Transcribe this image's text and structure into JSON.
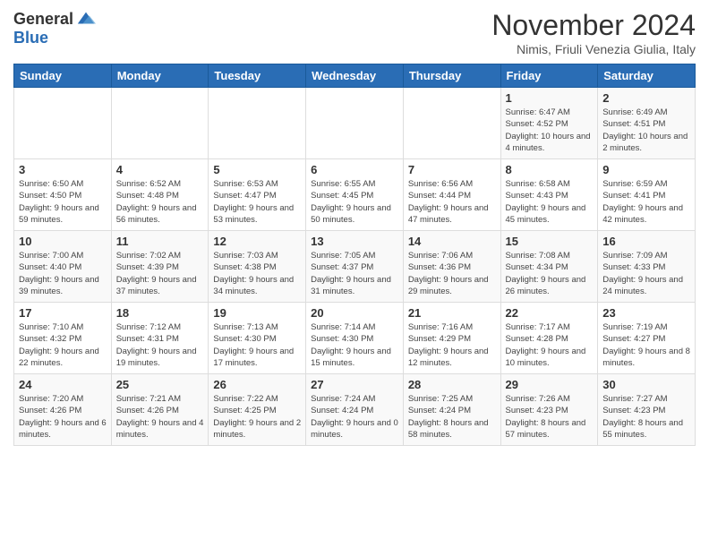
{
  "header": {
    "logo_general": "General",
    "logo_blue": "Blue",
    "month_title": "November 2024",
    "subtitle": "Nimis, Friuli Venezia Giulia, Italy"
  },
  "columns": [
    "Sunday",
    "Monday",
    "Tuesday",
    "Wednesday",
    "Thursday",
    "Friday",
    "Saturday"
  ],
  "weeks": [
    [
      {
        "day": "",
        "info": ""
      },
      {
        "day": "",
        "info": ""
      },
      {
        "day": "",
        "info": ""
      },
      {
        "day": "",
        "info": ""
      },
      {
        "day": "",
        "info": ""
      },
      {
        "day": "1",
        "info": "Sunrise: 6:47 AM\nSunset: 4:52 PM\nDaylight: 10 hours and 4 minutes."
      },
      {
        "day": "2",
        "info": "Sunrise: 6:49 AM\nSunset: 4:51 PM\nDaylight: 10 hours and 2 minutes."
      }
    ],
    [
      {
        "day": "3",
        "info": "Sunrise: 6:50 AM\nSunset: 4:50 PM\nDaylight: 9 hours and 59 minutes."
      },
      {
        "day": "4",
        "info": "Sunrise: 6:52 AM\nSunset: 4:48 PM\nDaylight: 9 hours and 56 minutes."
      },
      {
        "day": "5",
        "info": "Sunrise: 6:53 AM\nSunset: 4:47 PM\nDaylight: 9 hours and 53 minutes."
      },
      {
        "day": "6",
        "info": "Sunrise: 6:55 AM\nSunset: 4:45 PM\nDaylight: 9 hours and 50 minutes."
      },
      {
        "day": "7",
        "info": "Sunrise: 6:56 AM\nSunset: 4:44 PM\nDaylight: 9 hours and 47 minutes."
      },
      {
        "day": "8",
        "info": "Sunrise: 6:58 AM\nSunset: 4:43 PM\nDaylight: 9 hours and 45 minutes."
      },
      {
        "day": "9",
        "info": "Sunrise: 6:59 AM\nSunset: 4:41 PM\nDaylight: 9 hours and 42 minutes."
      }
    ],
    [
      {
        "day": "10",
        "info": "Sunrise: 7:00 AM\nSunset: 4:40 PM\nDaylight: 9 hours and 39 minutes."
      },
      {
        "day": "11",
        "info": "Sunrise: 7:02 AM\nSunset: 4:39 PM\nDaylight: 9 hours and 37 minutes."
      },
      {
        "day": "12",
        "info": "Sunrise: 7:03 AM\nSunset: 4:38 PM\nDaylight: 9 hours and 34 minutes."
      },
      {
        "day": "13",
        "info": "Sunrise: 7:05 AM\nSunset: 4:37 PM\nDaylight: 9 hours and 31 minutes."
      },
      {
        "day": "14",
        "info": "Sunrise: 7:06 AM\nSunset: 4:36 PM\nDaylight: 9 hours and 29 minutes."
      },
      {
        "day": "15",
        "info": "Sunrise: 7:08 AM\nSunset: 4:34 PM\nDaylight: 9 hours and 26 minutes."
      },
      {
        "day": "16",
        "info": "Sunrise: 7:09 AM\nSunset: 4:33 PM\nDaylight: 9 hours and 24 minutes."
      }
    ],
    [
      {
        "day": "17",
        "info": "Sunrise: 7:10 AM\nSunset: 4:32 PM\nDaylight: 9 hours and 22 minutes."
      },
      {
        "day": "18",
        "info": "Sunrise: 7:12 AM\nSunset: 4:31 PM\nDaylight: 9 hours and 19 minutes."
      },
      {
        "day": "19",
        "info": "Sunrise: 7:13 AM\nSunset: 4:30 PM\nDaylight: 9 hours and 17 minutes."
      },
      {
        "day": "20",
        "info": "Sunrise: 7:14 AM\nSunset: 4:30 PM\nDaylight: 9 hours and 15 minutes."
      },
      {
        "day": "21",
        "info": "Sunrise: 7:16 AM\nSunset: 4:29 PM\nDaylight: 9 hours and 12 minutes."
      },
      {
        "day": "22",
        "info": "Sunrise: 7:17 AM\nSunset: 4:28 PM\nDaylight: 9 hours and 10 minutes."
      },
      {
        "day": "23",
        "info": "Sunrise: 7:19 AM\nSunset: 4:27 PM\nDaylight: 9 hours and 8 minutes."
      }
    ],
    [
      {
        "day": "24",
        "info": "Sunrise: 7:20 AM\nSunset: 4:26 PM\nDaylight: 9 hours and 6 minutes."
      },
      {
        "day": "25",
        "info": "Sunrise: 7:21 AM\nSunset: 4:26 PM\nDaylight: 9 hours and 4 minutes."
      },
      {
        "day": "26",
        "info": "Sunrise: 7:22 AM\nSunset: 4:25 PM\nDaylight: 9 hours and 2 minutes."
      },
      {
        "day": "27",
        "info": "Sunrise: 7:24 AM\nSunset: 4:24 PM\nDaylight: 9 hours and 0 minutes."
      },
      {
        "day": "28",
        "info": "Sunrise: 7:25 AM\nSunset: 4:24 PM\nDaylight: 8 hours and 58 minutes."
      },
      {
        "day": "29",
        "info": "Sunrise: 7:26 AM\nSunset: 4:23 PM\nDaylight: 8 hours and 57 minutes."
      },
      {
        "day": "30",
        "info": "Sunrise: 7:27 AM\nSunset: 4:23 PM\nDaylight: 8 hours and 55 minutes."
      }
    ]
  ]
}
